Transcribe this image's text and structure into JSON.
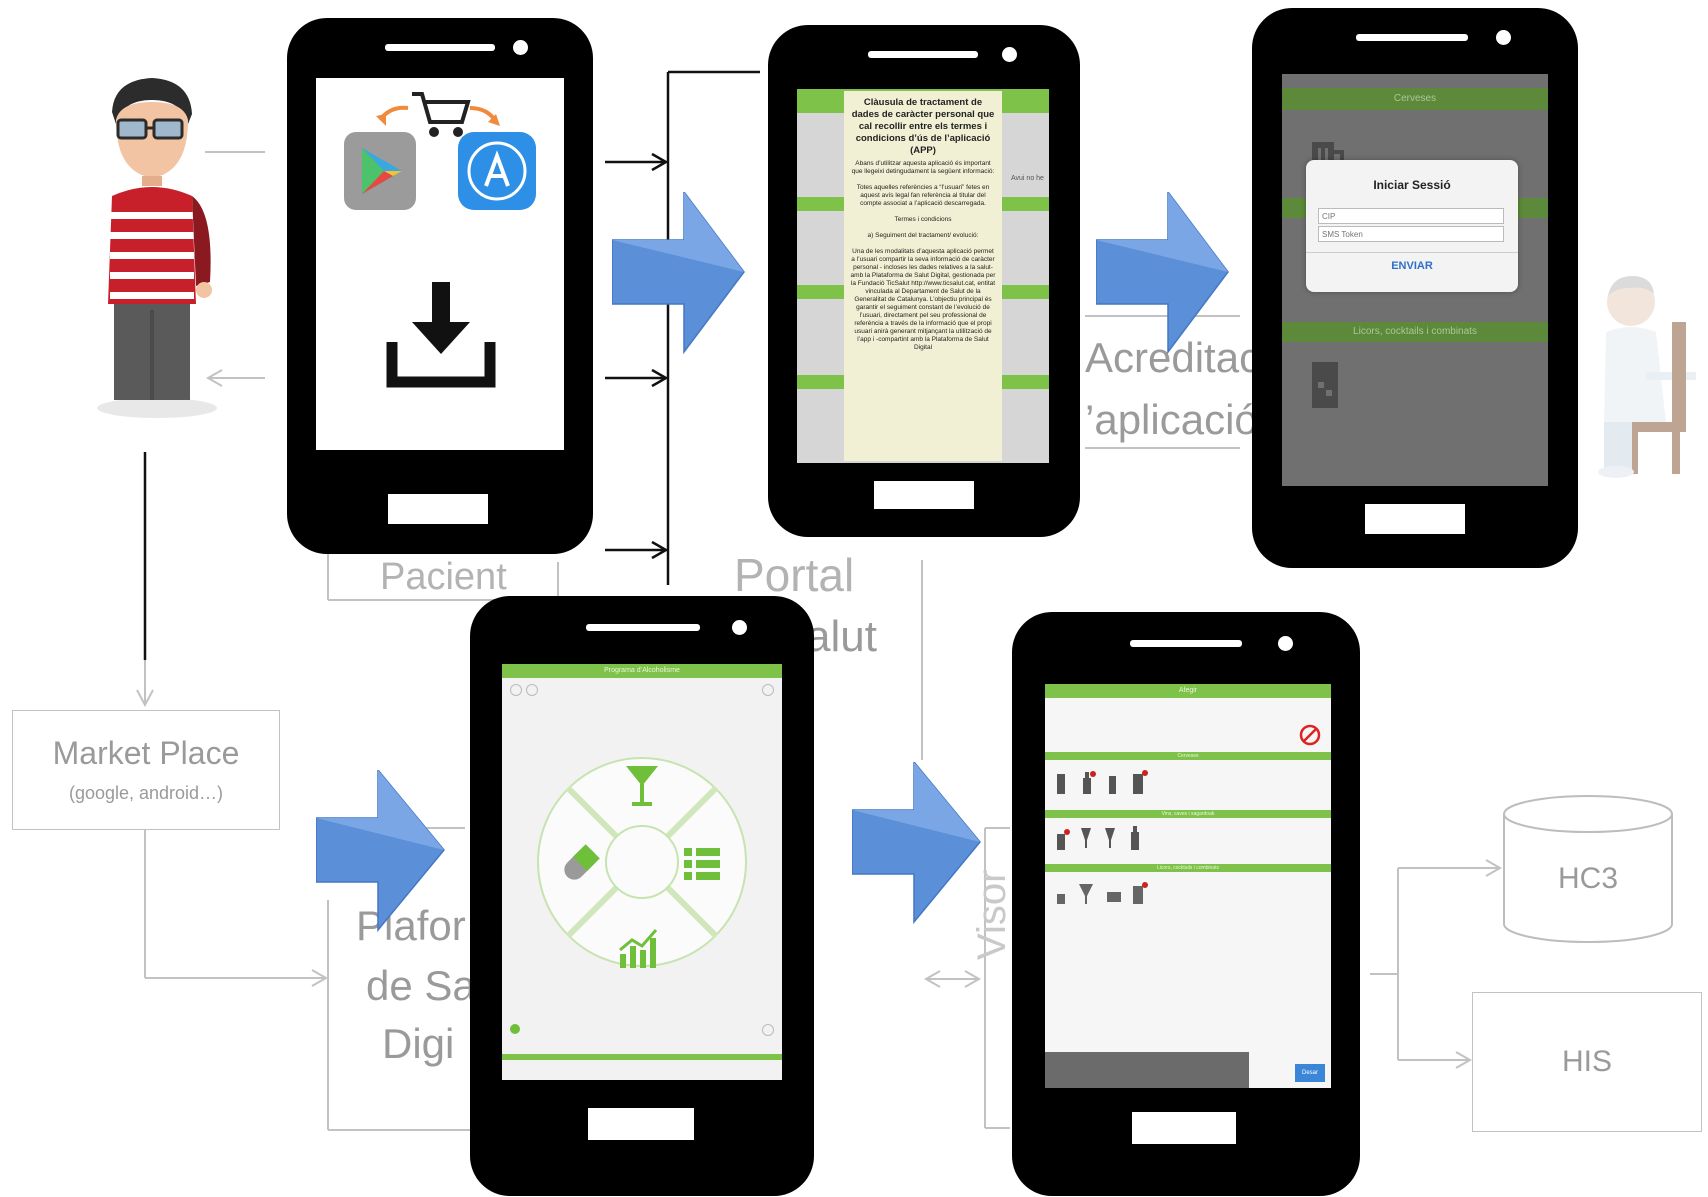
{
  "labels": {
    "market_place": "Market Place",
    "market_place_sub": "(google, android…)",
    "hc3": "HC3",
    "his": "HIS",
    "pacient": "Pacient",
    "portal": "Portal",
    "salut": "alut",
    "acreditac": "Acreditac",
    "aplicacio": "’aplicació",
    "plafor": "Plafor",
    "de_sa": "de Sa",
    "digi": "Digi",
    "visor": "Visor"
  },
  "phone_terms": {
    "title": "Clàusula de tractament de dades de caràcter personal que cal recollir entre els termes i condicions d’ús de l’aplicació (APP)",
    "intro": "Abans d’utilitzar aquesta aplicació és important que llegeixi detingudament la següent informació:",
    "p1": "Totes aquelles referències a “l’usuari” fetes en aquest avís legal fan referència al titular del compte associat a l’aplicació descarregada.",
    "bullet": "Termes i condicions",
    "item_a": "a)   Seguiment del tractament/ evolució:",
    "p2": "Una de les modalitats d’aquesta aplicació permet a l’usuari compartir la seva informació de caràcter personal - incloses les dades relatives a la salut- amb la Plataforma de Salut Digital, gestionada per la Fundació TicSalut http://www.ticsalut.cat, entitat vinculada al Departament de Salut de la Generalitat de Catalunya. L’objectiu principal és garantir el seguiment constant de l’evolució de l’usuari, directament pel seu professional de referència a través de la informació que el propi usuari anirà generant mitjançant la utilització de l’app i -compartint amb la Plataforma de Salut Digital",
    "side_text": "Avui no he"
  },
  "phone_login": {
    "header": "Cerveses",
    "dialog_title": "Iniciar Sessió",
    "field1_placeholder": "CIP",
    "field2_placeholder": "SMS Token",
    "submit": "ENVIAR",
    "section2": "Licors, cocktails i combinats"
  },
  "phone_menu": {
    "header": "Programa d’Alcoholisme"
  },
  "phone_record": {
    "header": "Afegir",
    "section1": "Cerveses",
    "section2": "Vins, caves i sagardoak",
    "section3": "Licors, cocktails i combinats",
    "save": "Desar"
  },
  "colors": {
    "app_green": "#7ec24a",
    "arrow_blue": "#5b8fd8",
    "box_grey": "#c2c2c2",
    "ghost_text": "#b3b3b3"
  },
  "icons": [
    "user-person-icon",
    "play-store-icon",
    "app-store-icon",
    "shopping-cart-icon",
    "download-icon",
    "doctor-icon",
    "cocktail-icon",
    "pill-icon",
    "list-icon",
    "chart-icon",
    "database-icon"
  ]
}
